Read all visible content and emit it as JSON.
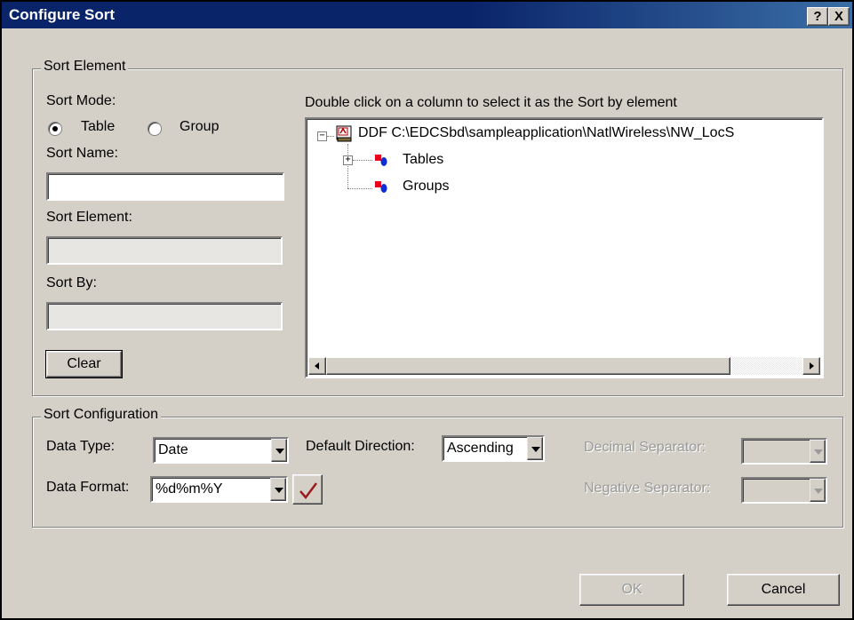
{
  "window": {
    "title": "Configure Sort",
    "help_label": "?",
    "close_label": "X"
  },
  "sort_element": {
    "legend": "Sort Element",
    "sort_mode_label": "Sort Mode:",
    "mode_table_label": "Table",
    "mode_group_label": "Group",
    "selected_mode": "Table",
    "sort_name_label": "Sort Name:",
    "sort_name_value": "",
    "sort_element_label": "Sort Element:",
    "sort_element_value": "",
    "sort_by_label": "Sort By:",
    "sort_by_value": "",
    "clear_label": "Clear",
    "instruction": "Double click on a column to select it as the Sort by element",
    "tree": {
      "root_label": "DDF C:\\EDCSbd\\sampleapplication\\NatlWireless\\NW_LocS",
      "root_expander": "−",
      "child_expander": "+",
      "children": [
        {
          "label": "Tables"
        },
        {
          "label": "Groups"
        }
      ]
    }
  },
  "sort_config": {
    "legend": "Sort Configuration",
    "data_type_label": "Data Type:",
    "data_type_value": "Date",
    "default_direction_label": "Default Direction:",
    "default_direction_value": "Ascending",
    "decimal_separator_label": "Decimal Separator:",
    "decimal_separator_value": "",
    "data_format_label": "Data Format:",
    "data_format_value": "%d%m%Y",
    "negative_separator_label": "Negative Separator:",
    "negative_separator_value": ""
  },
  "footer": {
    "ok_label": "OK",
    "cancel_label": "Cancel"
  },
  "colors": {
    "titlebar": "#0a246a",
    "face": "#d4d0c8",
    "checkmark": "#9b1c1c",
    "icon_red": "#e8001c",
    "icon_blue": "#0a2fd8"
  }
}
